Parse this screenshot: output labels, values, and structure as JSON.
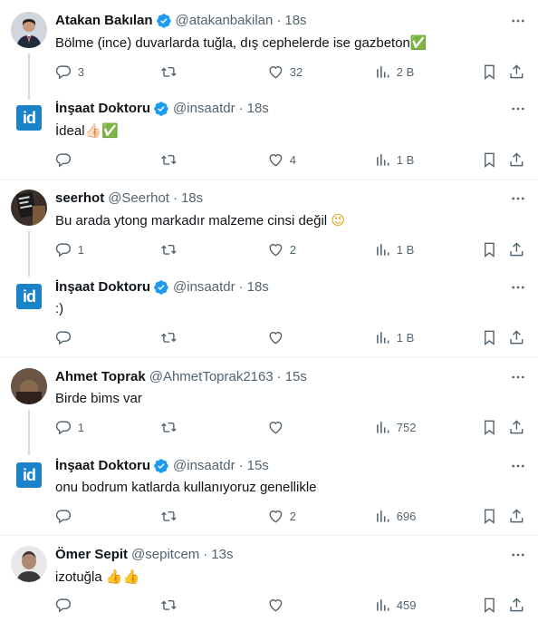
{
  "tweets": [
    {
      "name": "Atakan Bakılan",
      "handle": "@atakanbakilan",
      "time": "18s",
      "verified": true,
      "text": "Bölme (ince) duvarlarda tuğla, dış cephelerde ise gazbeton",
      "emoji": "✅",
      "replies": "3",
      "retweets": "",
      "likes": "32",
      "views": "2 B"
    },
    {
      "name": "İnşaat Doktoru",
      "handle": "@insaatdr",
      "time": "18s",
      "verified": true,
      "text": "İdeal",
      "emoji": "👍🏻✅",
      "replies": "",
      "retweets": "",
      "likes": "4",
      "views": "1 B"
    },
    {
      "name": "seerhot",
      "handle": "@Seerhot",
      "time": "18s",
      "verified": false,
      "text": "Bu arada ytong markadır malzeme cinsi değil",
      "emoji": "😉",
      "replies": "1",
      "retweets": "",
      "likes": "2",
      "views": "1 B"
    },
    {
      "name": "İnşaat Doktoru",
      "handle": "@insaatdr",
      "time": "18s",
      "verified": true,
      "text": ":)",
      "emoji": "",
      "replies": "",
      "retweets": "",
      "likes": "",
      "views": "1 B"
    },
    {
      "name": "Ahmet Toprak",
      "handle": "@AhmetToprak2163",
      "time": "15s",
      "verified": false,
      "text": "Birde bims var",
      "emoji": "",
      "replies": "1",
      "retweets": "",
      "likes": "",
      "views": "752"
    },
    {
      "name": "İnşaat Doktoru",
      "handle": "@insaatdr",
      "time": "15s",
      "verified": true,
      "text": "onu bodrum katlarda kullanıyoruz genellikle",
      "emoji": "",
      "replies": "",
      "retweets": "",
      "likes": "2",
      "views": "696"
    },
    {
      "name": "Ömer Sepit",
      "handle": "@sepitcem",
      "time": "13s",
      "verified": false,
      "text": "izotuğla",
      "emoji": "👍👍",
      "replies": "",
      "retweets": "",
      "likes": "",
      "views": "459"
    }
  ],
  "separator": "·",
  "icons": {
    "more": "more-icon",
    "reply": "reply-icon",
    "retweet": "retweet-icon",
    "like": "like-icon",
    "views": "views-icon",
    "bookmark": "bookmark-icon",
    "share": "share-icon",
    "verified": "verified-badge-icon"
  },
  "colors": {
    "text": "#0f1419",
    "secondary": "#536471",
    "verified": "#1d9bf0",
    "divider": "#eff3f4",
    "thread": "#cfd9de",
    "brand_logo": "#1a82c9"
  },
  "logo_text": "id"
}
